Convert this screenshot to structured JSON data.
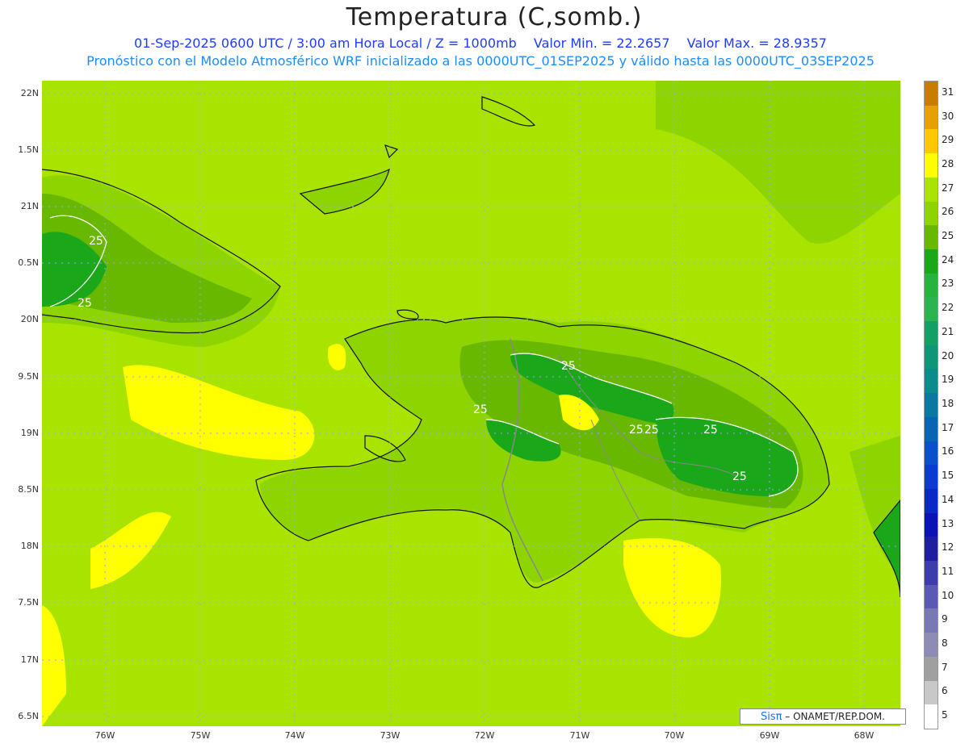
{
  "header": {
    "title": "Temperatura (C,somb.)",
    "subtitle_date": "01-Sep-2025 0600 UTC / 3:00 am Hora Local / Z = 1000mb",
    "subtitle_min": "Valor Min. = 22.2657",
    "subtitle_max": "Valor Max. = 28.9357",
    "subtitle_model": "Pronóstico con el Modelo Atmosférico WRF inicializado a las 0000UTC_01SEP2025 y válido hasta las  0000UTC_03SEP2025"
  },
  "axes": {
    "lat_labels": [
      "22N",
      "1.5N",
      "21N",
      "0.5N",
      "20N",
      "9.5N",
      "19N",
      "8.5N",
      "18N",
      "7.5N",
      "17N",
      "6.5N"
    ],
    "lon_labels": [
      "76W",
      "75W",
      "74W",
      "73W",
      "72W",
      "71W",
      "70W",
      "69W",
      "68W"
    ]
  },
  "map": {
    "contour_labels": [
      "25",
      "25",
      "25",
      "25",
      "25",
      "25",
      "25",
      "25"
    ],
    "colors": {
      "sea": "#a8e400",
      "warm": "#ffff00",
      "land_light": "#8ed400",
      "land_mid": "#68b800",
      "land_dark": "#1aa81a"
    }
  },
  "colorbar": {
    "labels": [
      "31",
      "30",
      "29",
      "28",
      "27",
      "26",
      "25",
      "24",
      "23",
      "22",
      "21",
      "20",
      "19",
      "18",
      "17",
      "16",
      "15",
      "14",
      "13",
      "12",
      "11",
      "10",
      "9",
      "8",
      "7",
      "6",
      "5"
    ],
    "colors": [
      "#c87d00",
      "#e6a000",
      "#ffc800",
      "#ffff00",
      "#a8e400",
      "#8ed400",
      "#68b800",
      "#1aa81a",
      "#28b43c",
      "#2db450",
      "#14a064",
      "#0f9678",
      "#0a8c8c",
      "#0a78a0",
      "#0a64b4",
      "#0a50c8",
      "#0a3cd2",
      "#0a28c8",
      "#0a14b4",
      "#1e1ea0",
      "#3c3caa",
      "#5a5ab4",
      "#7878b4",
      "#8c8cb4",
      "#a0a0a0",
      "#c8c8c8",
      "#ffffff"
    ]
  },
  "footer": {
    "brand": "Sisπ",
    "credit": " – ONAMET/REP.DOM."
  }
}
